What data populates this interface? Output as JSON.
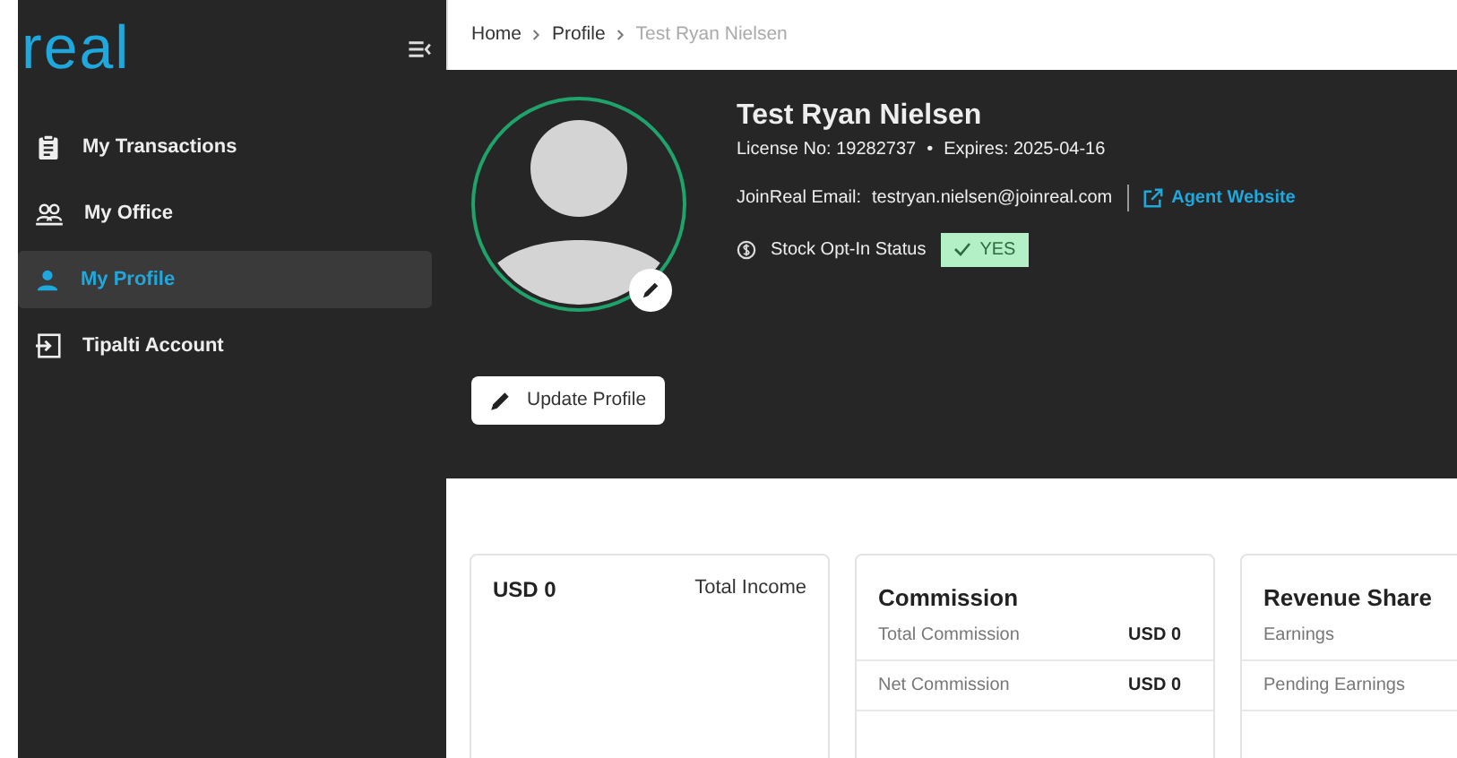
{
  "sidebar": {
    "logo": "real",
    "items": [
      {
        "label": "My Transactions",
        "selected": false
      },
      {
        "label": "My Office",
        "selected": false
      },
      {
        "label": "My Profile",
        "selected": true
      },
      {
        "label": "Tipalti Account",
        "selected": false
      }
    ]
  },
  "breadcrumb": [
    {
      "label": "Home",
      "current": false
    },
    {
      "label": "Profile",
      "current": false
    },
    {
      "label": "Test Ryan Nielsen",
      "current": true
    }
  ],
  "profile": {
    "name": "Test Ryan Nielsen",
    "license": "License No: 19282737",
    "separator": "•",
    "expires": "Expires: 2025-04-16",
    "email_label": "JoinReal Email:",
    "email": "testryan.nielsen@joinreal.com",
    "website": "Agent Website",
    "stock_label": "Stock Opt-In Status",
    "stock_status": {
      "label": "YES",
      "checked": true
    },
    "update_button": "Update Profile"
  },
  "cards": [
    {
      "kind": "income",
      "amount": "USD 0",
      "title": "Total Income"
    },
    {
      "kind": "table",
      "title": "Commission",
      "rows": [
        {
          "label": "Total Commission",
          "value": "USD 0"
        },
        {
          "label": "Net Commission",
          "value": "USD 0"
        }
      ]
    },
    {
      "kind": "table",
      "title": "Revenue Share",
      "rows": [
        {
          "label": "Earnings"
        },
        {
          "label": "Pending Earnings"
        }
      ]
    }
  ]
}
